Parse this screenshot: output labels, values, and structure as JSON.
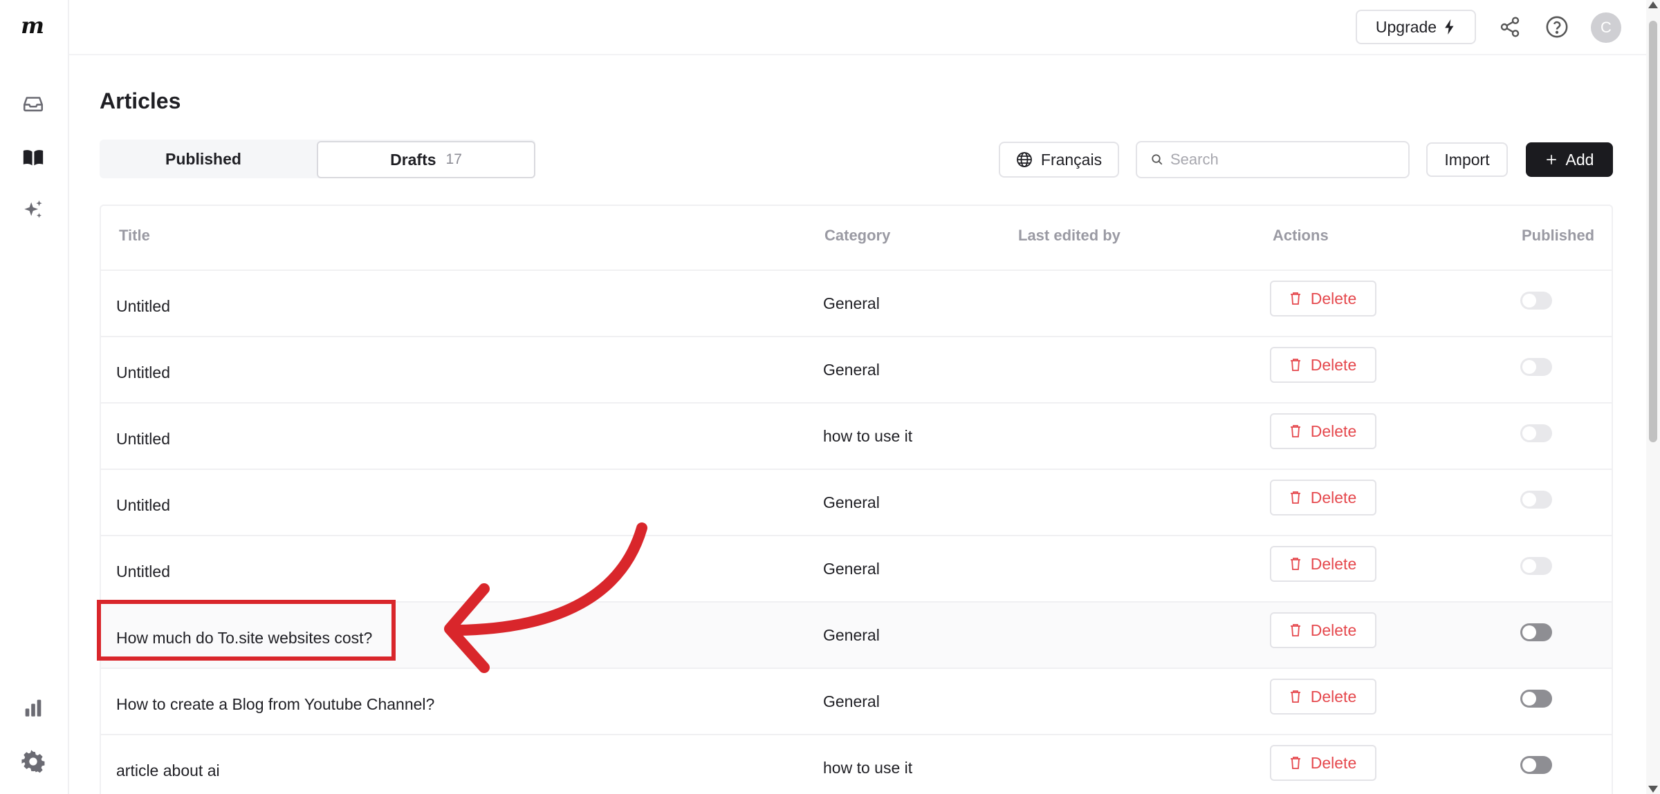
{
  "app": {
    "logo_text": "m"
  },
  "header": {
    "upgrade_label": "Upgrade",
    "avatar_initial": "C"
  },
  "page": {
    "title": "Articles"
  },
  "tabs": {
    "published_label": "Published",
    "drafts_label": "Drafts",
    "drafts_count": "17"
  },
  "toolbar": {
    "language_label": "Français",
    "search_placeholder": "Search",
    "import_label": "Import",
    "add_label": "Add"
  },
  "table": {
    "columns": {
      "title": "Title",
      "category": "Category",
      "last_edited_by": "Last edited by",
      "actions": "Actions",
      "published": "Published"
    },
    "delete_label": "Delete",
    "rows": [
      {
        "title": "Untitled",
        "category": "General",
        "published": false
      },
      {
        "title": "Untitled",
        "category": "General",
        "published": false
      },
      {
        "title": "Untitled",
        "category": "how to use it",
        "published": false
      },
      {
        "title": "Untitled",
        "category": "General",
        "published": false
      },
      {
        "title": "Untitled",
        "category": "General",
        "published": false
      },
      {
        "title": "How much do To.site websites cost?",
        "category": "General",
        "published": false
      },
      {
        "title": "How to create a Blog from Youtube Channel?",
        "category": "General",
        "published": false
      },
      {
        "title": "article about ai",
        "category": "how to use it",
        "published": false
      }
    ]
  },
  "colors": {
    "accent_dark": "#1b1b1f",
    "delete_red": "#e5484d",
    "annotation_red": "#d9262b"
  }
}
